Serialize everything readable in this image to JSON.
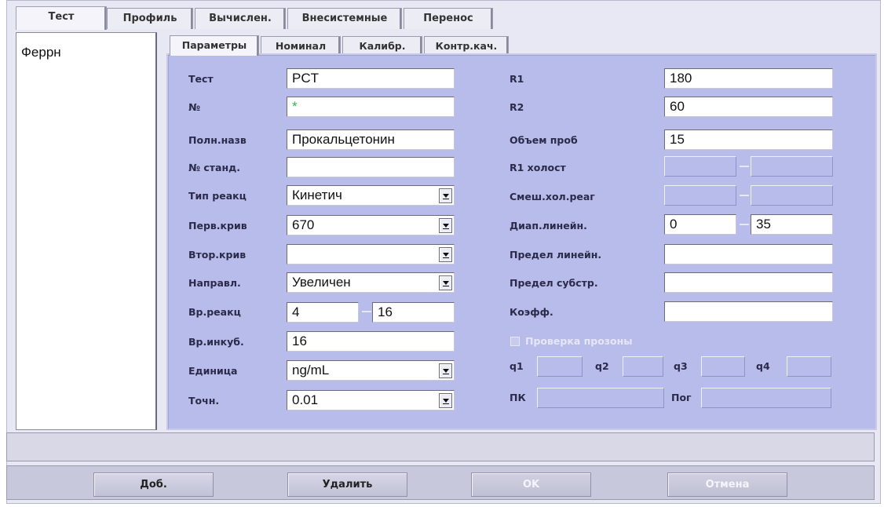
{
  "top_tabs": [
    "Тест",
    "Профиль",
    "Вычислен.",
    "Внесистемные",
    "Перенос"
  ],
  "test_list": [
    "Феррн"
  ],
  "sub_tabs": [
    "Параметры",
    "Номинал",
    "Калибр.",
    "Контр.кач."
  ],
  "left_fields": {
    "test": {
      "label": "Тест",
      "value": "PCT"
    },
    "number": {
      "label": "№",
      "value": "*"
    },
    "full_name": {
      "label": "Полн.назв",
      "value": "Прокальцетонин"
    },
    "std_number": {
      "label": "№ станд.",
      "value": ""
    },
    "reaction_type": {
      "label": "Тип реакц",
      "value": "Кинетич"
    },
    "first_curve": {
      "label": "Перв.крив",
      "value": "670"
    },
    "second_curve": {
      "label": "Втор.крив",
      "value": ""
    },
    "direction": {
      "label": "Направл.",
      "value": "Увеличен"
    },
    "reaction_time": {
      "label": "Вр.реакц",
      "value_from": "4",
      "value_to": "16"
    },
    "incubation_time": {
      "label": "Вр.инкуб.",
      "value": "16"
    },
    "unit": {
      "label": "Единица",
      "value": "ng/mL"
    },
    "precision": {
      "label": "Точн.",
      "value": "0.01"
    }
  },
  "right_fields": {
    "r1": {
      "label": "R1",
      "value": "180"
    },
    "r2": {
      "label": "R2",
      "value": "60"
    },
    "sample_volume": {
      "label": "Объем проб",
      "value": "15"
    },
    "r1_blank": {
      "label": "R1 холост",
      "value_from": "",
      "value_to": ""
    },
    "mixed_blank": {
      "label": "Смеш.хол.реаг",
      "value_from": "",
      "value_to": ""
    },
    "linear_range": {
      "label": "Диап.линейн.",
      "value_from": "0",
      "value_to": "35"
    },
    "linear_limit": {
      "label": "Предел линейн.",
      "value": ""
    },
    "substrate_limit": {
      "label": "Предел субстр.",
      "value": ""
    },
    "coefficient": {
      "label": "Коэфф.",
      "value": ""
    }
  },
  "prozone": {
    "label": "Проверка прозоны",
    "checked": false
  },
  "q_fields": {
    "q1": "q1",
    "q2": "q2",
    "q3": "q3",
    "q4": "q4"
  },
  "pk_label": "ПК",
  "por_label": "Пог",
  "buttons": {
    "add": "Доб.",
    "delete": "Удалить",
    "ok": "OK",
    "cancel": "Отмена"
  }
}
